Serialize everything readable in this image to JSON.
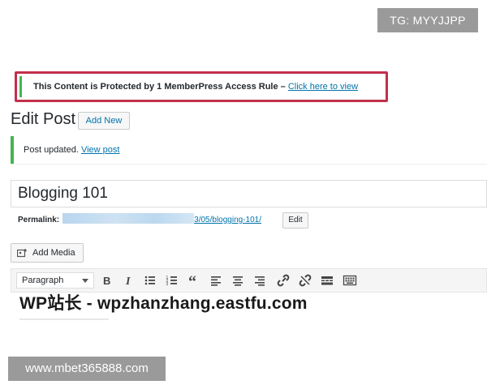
{
  "watermarks": {
    "top": "TG: MYYJJPP",
    "bottom": "www.mbet365888.com",
    "editor": "WP站长 - wpzhanzhang.eastfu.com"
  },
  "protect_notice": {
    "message": "This Content is Protected by 1 MemberPress Access Rule –",
    "link": "Click here to view"
  },
  "header": {
    "title": "Edit Post",
    "add_new_label": "Add New"
  },
  "updated_notice": {
    "message": "Post updated.",
    "link": "View post"
  },
  "post": {
    "title": "Blogging 101",
    "permalink_label": "Permalink:",
    "permalink_slug": "3/05/blogging-101/",
    "permalink_edit_label": "Edit"
  },
  "media": {
    "add_media_label": "Add Media"
  },
  "toolbar": {
    "format_value": "Paragraph",
    "buttons": [
      "bold-icon",
      "italic-icon",
      "bullet-list-icon",
      "numbered-list-icon",
      "blockquote-icon",
      "align-left-icon",
      "align-center-icon",
      "align-right-icon",
      "link-icon",
      "unlink-icon",
      "read-more-icon",
      "toolbar-toggle-icon"
    ]
  },
  "colors": {
    "notice_border": "#c2304a",
    "success": "#46b450",
    "link": "#0073aa",
    "watermark_bg": "#9a9a9a"
  }
}
